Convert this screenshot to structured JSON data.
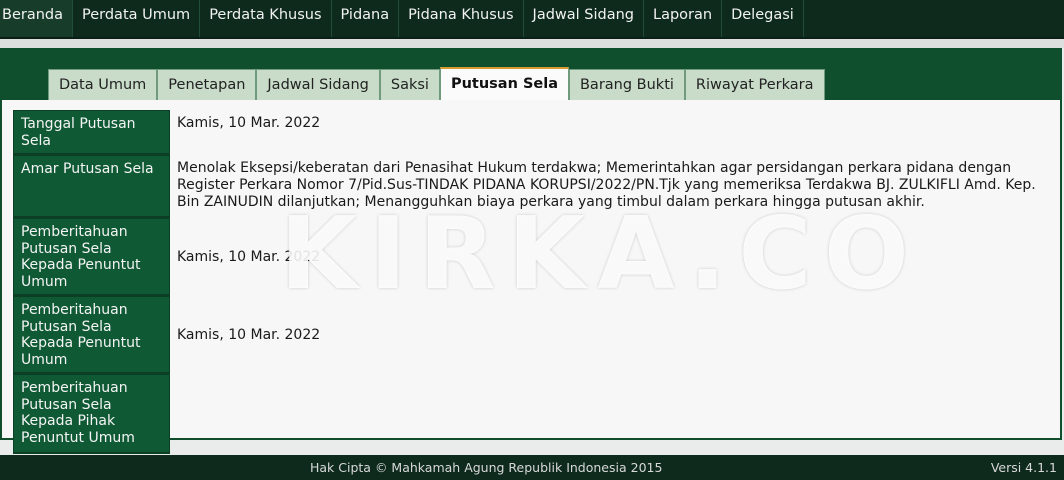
{
  "nav": {
    "items": [
      "Beranda",
      "Perdata Umum",
      "Perdata Khusus",
      "Pidana",
      "Pidana Khusus",
      "Jadwal Sidang",
      "Laporan",
      "Delegasi"
    ]
  },
  "tabs": [
    "Data Umum",
    "Penetapan",
    "Jadwal Sidang",
    "Saksi",
    "Putusan Sela",
    "Barang Bukti",
    "Riwayat Perkara"
  ],
  "active_tab": "Putusan Sela",
  "rows": [
    {
      "label": "Tanggal Putusan Sela",
      "value": "Kamis, 10 Mar. 2022"
    },
    {
      "label": "Amar Putusan Sela",
      "value": "Menolak Eksepsi/keberatan dari Penasihat Hukum terdakwa; Memerintahkan agar persidangan perkara pidana dengan Register Perkara Nomor 7/Pid.Sus-TINDAK PIDANA KORUPSI/2022/PN.Tjk yang memeriksa Terdakwa BJ. ZULKIFLI Amd. Kep. Bin ZAINUDIN dilanjutkan; Menangguhkan biaya perkara yang timbul dalam perkara hingga putusan akhir."
    },
    {
      "label": "Pemberitahuan Putusan Sela Kepada Penuntut Umum",
      "value": "Kamis, 10 Mar. 2022"
    },
    {
      "label": "Pemberitahuan Putusan Sela Kepada Penuntut Umum",
      "value": "Kamis, 10 Mar. 2022"
    },
    {
      "label": "Pemberitahuan Putusan Sela Kepada Pihak Penuntut Umum",
      "value": ""
    }
  ],
  "watermark": "KIRKA.CO",
  "footer": {
    "copyright": "Hak Cipta © Mahkamah Agung Republik Indonesia 2015",
    "version": "Versi 4.1.1"
  },
  "colors": {
    "nav_bg": "#0d2a1c",
    "brand_green": "#0f5a35",
    "tab_bg": "#c9dcc9",
    "active_tab_accent": "#d79b2f"
  }
}
